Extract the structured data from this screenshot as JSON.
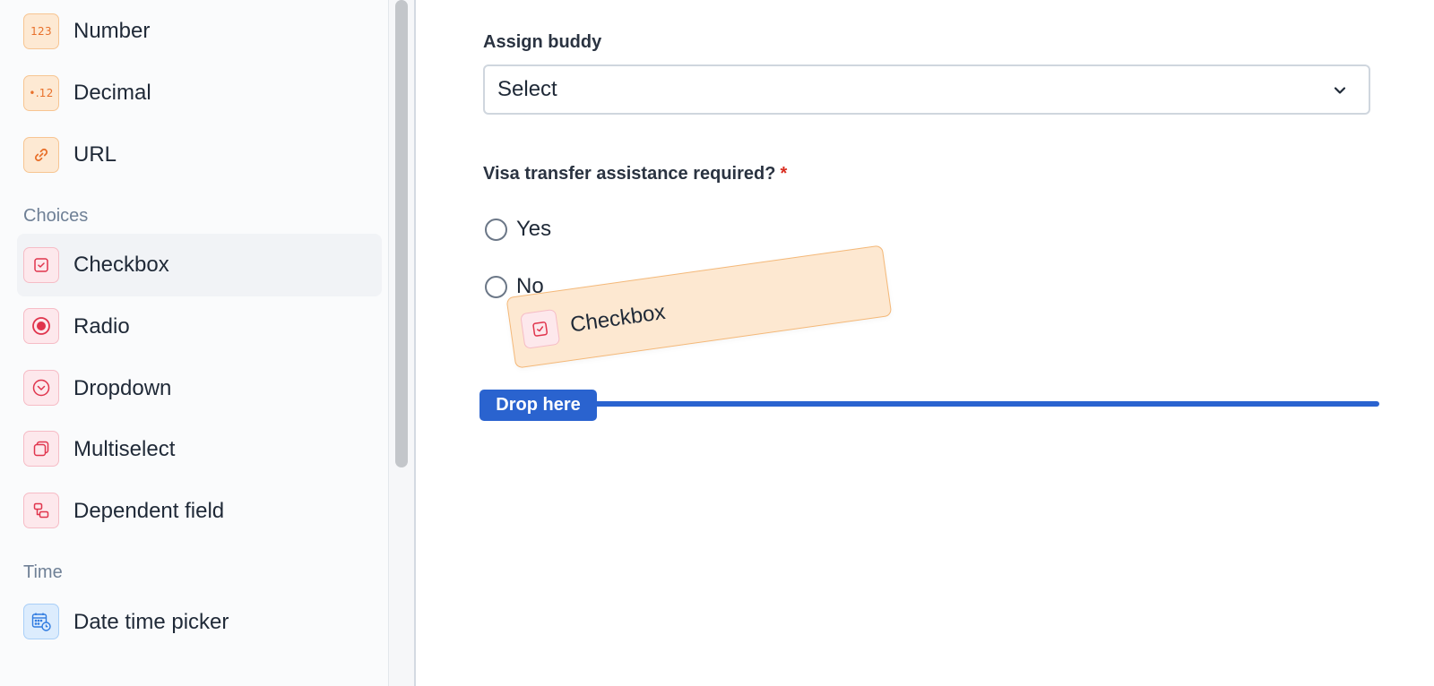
{
  "sidebar": {
    "items_top": [
      {
        "label": "Number",
        "icon": "number-icon",
        "icon_text": "123"
      },
      {
        "label": "Decimal",
        "icon": "decimal-icon",
        "icon_text": "•.12"
      },
      {
        "label": "URL",
        "icon": "link-icon"
      }
    ],
    "sections": {
      "choices": "Choices",
      "time": "Time"
    },
    "choices_items": [
      {
        "label": "Checkbox",
        "icon": "checkbox-icon",
        "active": true
      },
      {
        "label": "Radio",
        "icon": "radio-icon"
      },
      {
        "label": "Dropdown",
        "icon": "dropdown-icon"
      },
      {
        "label": "Multiselect",
        "icon": "multiselect-icon"
      },
      {
        "label": "Dependent field",
        "icon": "dependent-field-icon"
      }
    ],
    "time_items": [
      {
        "label": "Date time picker",
        "icon": "calendar-clock-icon"
      }
    ]
  },
  "form": {
    "assign_buddy": {
      "label": "Assign buddy",
      "value": "Select"
    },
    "visa": {
      "label": "Visa transfer assistance required?",
      "required_mark": "*",
      "options": [
        "Yes",
        "No"
      ]
    }
  },
  "drag": {
    "ghost_label": "Checkbox",
    "drop_label": "Drop here"
  },
  "colors": {
    "accent": "#2a63cf",
    "orange_icon_bg": "#fde9d3",
    "pink_icon_bg": "#fde8ec",
    "blue_icon_bg": "#dcecfd",
    "ghost_bg": "#fde8d1",
    "required": "#d92d20"
  }
}
